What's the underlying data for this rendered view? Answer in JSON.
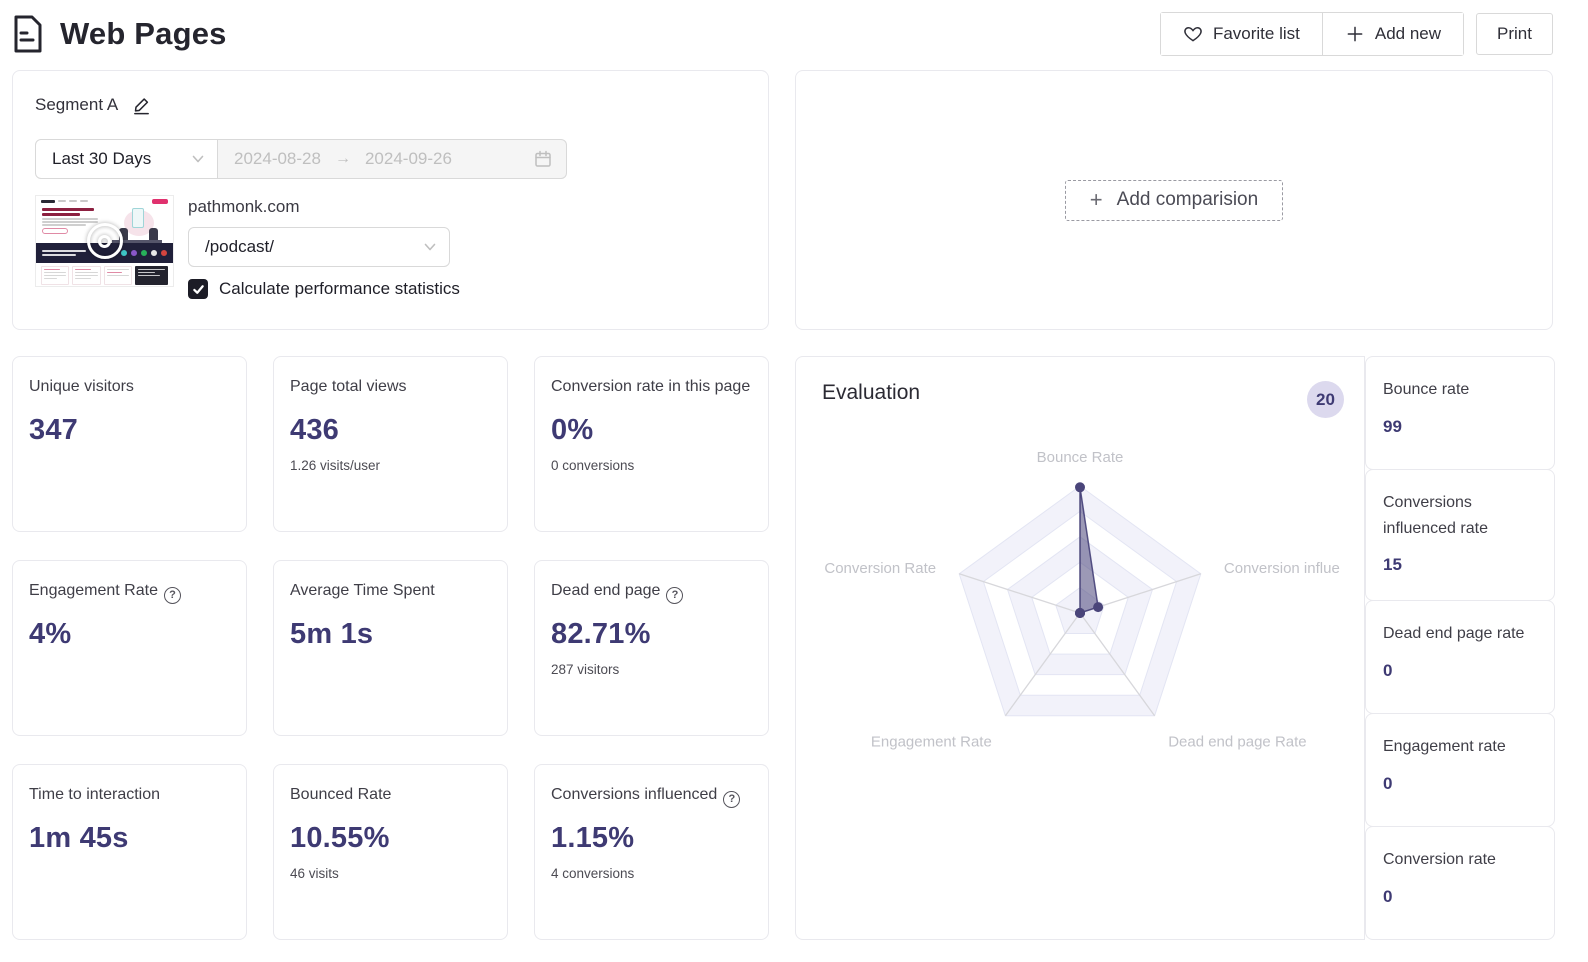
{
  "header": {
    "title": "Web Pages",
    "favorite_list_label": "Favorite list",
    "add_new_label": "Add new",
    "print_label": "Print"
  },
  "segment": {
    "name": "Segment A",
    "date_preset": "Last 30 Days",
    "date_start": "2024-08-28",
    "date_end": "2024-09-26",
    "domain": "pathmonk.com",
    "page_path": "/podcast/",
    "checkbox_label": "Calculate performance statistics",
    "checkbox_checked": true
  },
  "comparison": {
    "add_label": "Add comparision"
  },
  "metrics": [
    {
      "label": "Unique visitors",
      "value": "347",
      "sub": "",
      "help": false
    },
    {
      "label": "Page total views",
      "value": "436",
      "sub": "1.26 visits/user",
      "help": false
    },
    {
      "label": "Conversion rate in this page",
      "value": "0%",
      "sub": "0 conversions",
      "help": false
    },
    {
      "label": "Engagement Rate",
      "value": "4%",
      "sub": "",
      "help": true
    },
    {
      "label": "Average Time Spent",
      "value": "5m 1s",
      "sub": "",
      "help": false
    },
    {
      "label": "Dead end page",
      "value": "82.71%",
      "sub": "287 visitors",
      "help": true
    },
    {
      "label": "Time to interaction",
      "value": "1m 45s",
      "sub": "",
      "help": false
    },
    {
      "label": "Bounced Rate",
      "value": "10.55%",
      "sub": "46 visits",
      "help": false
    },
    {
      "label": "Conversions influenced",
      "value": "1.15%",
      "sub": "4 conversions",
      "help": true
    }
  ],
  "evaluation": {
    "title": "Evaluation",
    "score_badge": "20",
    "chart_data": {
      "type": "radar",
      "axes": [
        "Bounce Rate",
        "Conversion influe",
        "Dead end page Rate",
        "Engagement Rate",
        "Conversion Rate"
      ],
      "values": [
        99,
        15,
        0,
        0,
        0
      ],
      "max": 100,
      "rings": 5,
      "legend_position": "none"
    }
  },
  "side_stats": [
    {
      "label": "Bounce rate",
      "value": "99"
    },
    {
      "label": "Conversions influenced rate",
      "value": "15"
    },
    {
      "label": "Dead end page rate",
      "value": "0"
    },
    {
      "label": "Engagement rate",
      "value": "0"
    },
    {
      "label": "Conversion rate",
      "value": "0"
    }
  ],
  "icons": {
    "question_mark": "?",
    "plus": "+",
    "arrow_right": "→"
  },
  "colors": {
    "accent": "#3e3a73",
    "badge_bg": "#dcd9ee",
    "radar_fill": "rgba(74,69,122,0.55)",
    "radar_label": "#c1c2c8",
    "disabled_bg": "#f5f5f5",
    "disabled_text": "#bfbfbf",
    "card_border": "#e9e9ee"
  }
}
